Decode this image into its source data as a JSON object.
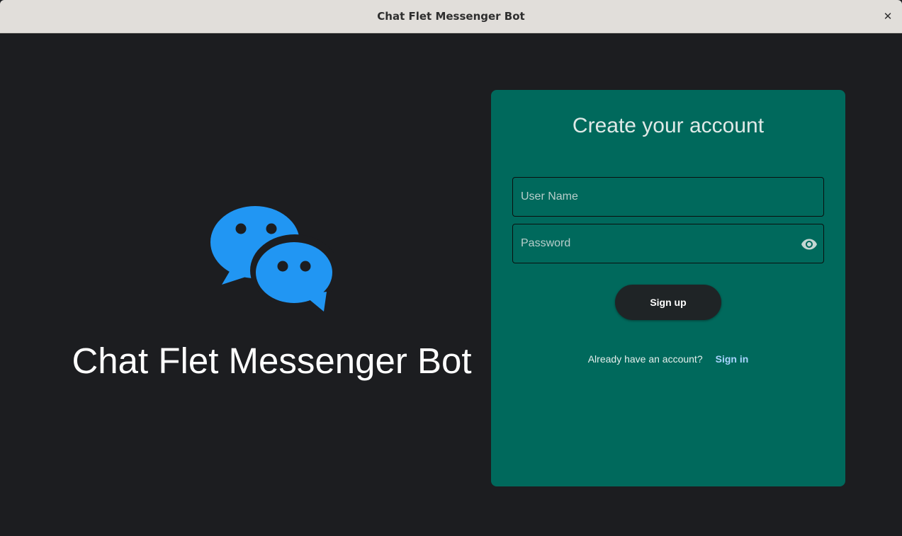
{
  "window": {
    "title": "Chat Flet Messenger Bot",
    "close_symbol": "✕"
  },
  "brand": {
    "title": "Chat Flet Messenger Bot",
    "icon": "wechat-chat-bubbles-icon",
    "icon_color": "#2196f3"
  },
  "signup_card": {
    "title": "Create your account",
    "background_color": "#00695c",
    "username": {
      "placeholder": "User Name",
      "value": ""
    },
    "password": {
      "placeholder": "Password",
      "value": "",
      "toggle_icon": "eye-icon"
    },
    "signup_button_label": "Sign up",
    "signin_prompt": "Already have an account?",
    "signin_link_label": "Sign in",
    "signin_link_color": "#a8d4ff"
  }
}
